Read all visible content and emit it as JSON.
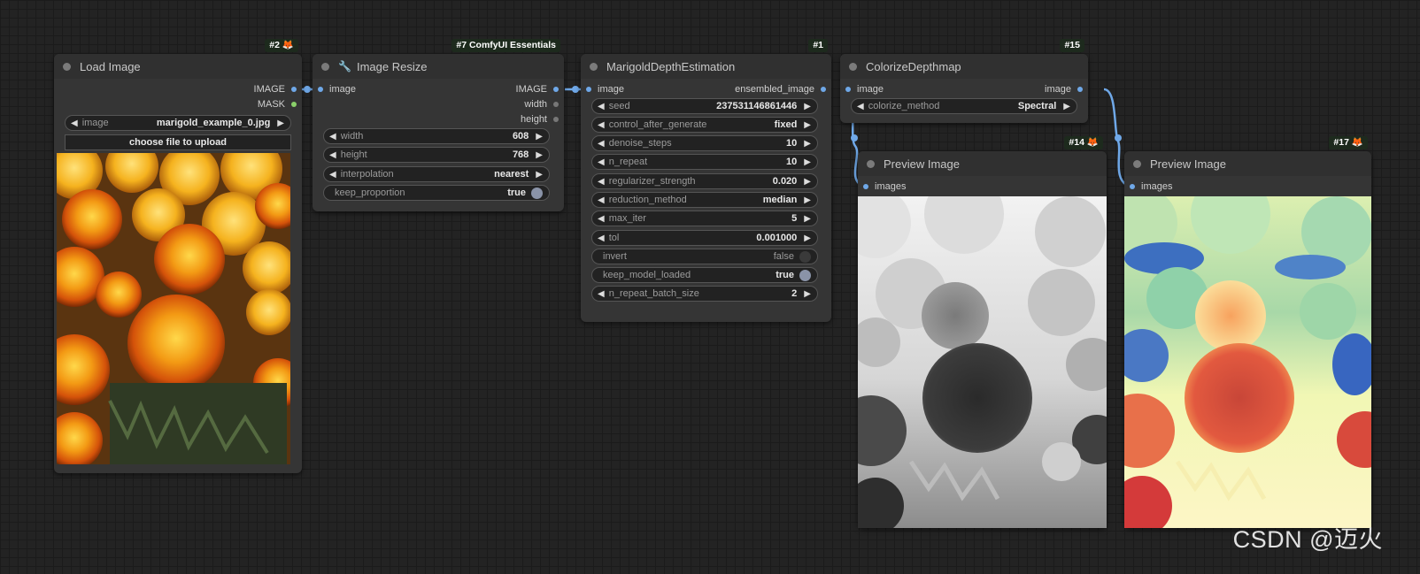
{
  "colors": {
    "link_image": "#6fa8e8",
    "link_mask": "#8ad06a",
    "badge_bg": "#1d2a1d",
    "node_bg": "#353535",
    "canvas_bg": "#232323"
  },
  "nodes": {
    "load_image": {
      "title": "Load Image",
      "badge": "#2",
      "badge_icon": "fox-icon",
      "outputs": [
        "IMAGE",
        "MASK"
      ],
      "widget_image": {
        "name": "image",
        "value": "marigold_example_0.jpg"
      },
      "upload_label": "choose file to upload",
      "preview": "marigold-photo"
    },
    "image_resize": {
      "title": "Image Resize",
      "badge": "#7 ComfyUI Essentials",
      "title_icon": "wrench-icon",
      "input": "image",
      "outputs": [
        "IMAGE",
        "width",
        "height"
      ],
      "widgets": [
        {
          "name": "width",
          "value": "608"
        },
        {
          "name": "height",
          "value": "768"
        },
        {
          "name": "interpolation",
          "value": "nearest"
        }
      ],
      "toggle": {
        "name": "keep_proportion",
        "value": "true"
      }
    },
    "marigold": {
      "title": "MarigoldDepthEstimation",
      "badge": "#1",
      "input": "image",
      "output": "ensembled_image",
      "widgets": [
        {
          "name": "seed",
          "value": "237531146861446"
        },
        {
          "name": "control_after_generate",
          "value": "fixed"
        },
        {
          "name": "denoise_steps",
          "value": "10"
        },
        {
          "name": "n_repeat",
          "value": "10"
        },
        {
          "name": "regularizer_strength",
          "value": "0.020"
        },
        {
          "name": "reduction_method",
          "value": "median"
        },
        {
          "name": "max_iter",
          "value": "5"
        },
        {
          "name": "tol",
          "value": "0.001000"
        }
      ],
      "toggles": [
        {
          "name": "invert",
          "value": "false"
        },
        {
          "name": "keep_model_loaded",
          "value": "true"
        }
      ],
      "last_widget": {
        "name": "n_repeat_batch_size",
        "value": "2"
      }
    },
    "colorize": {
      "title": "ColorizeDepthmap",
      "badge": "#15",
      "input": "image",
      "output": "image",
      "widget": {
        "name": "colorize_method",
        "value": "Spectral"
      }
    },
    "preview14": {
      "title": "Preview Image",
      "badge": "#14",
      "badge_icon": "fox-icon",
      "input": "images",
      "preview": "grayscale-depth-map"
    },
    "preview17": {
      "title": "Preview Image",
      "badge": "#17",
      "badge_icon": "fox-icon",
      "input": "images",
      "preview": "spectral-colorized-depth-map"
    }
  },
  "watermark": "CSDN @迈火"
}
